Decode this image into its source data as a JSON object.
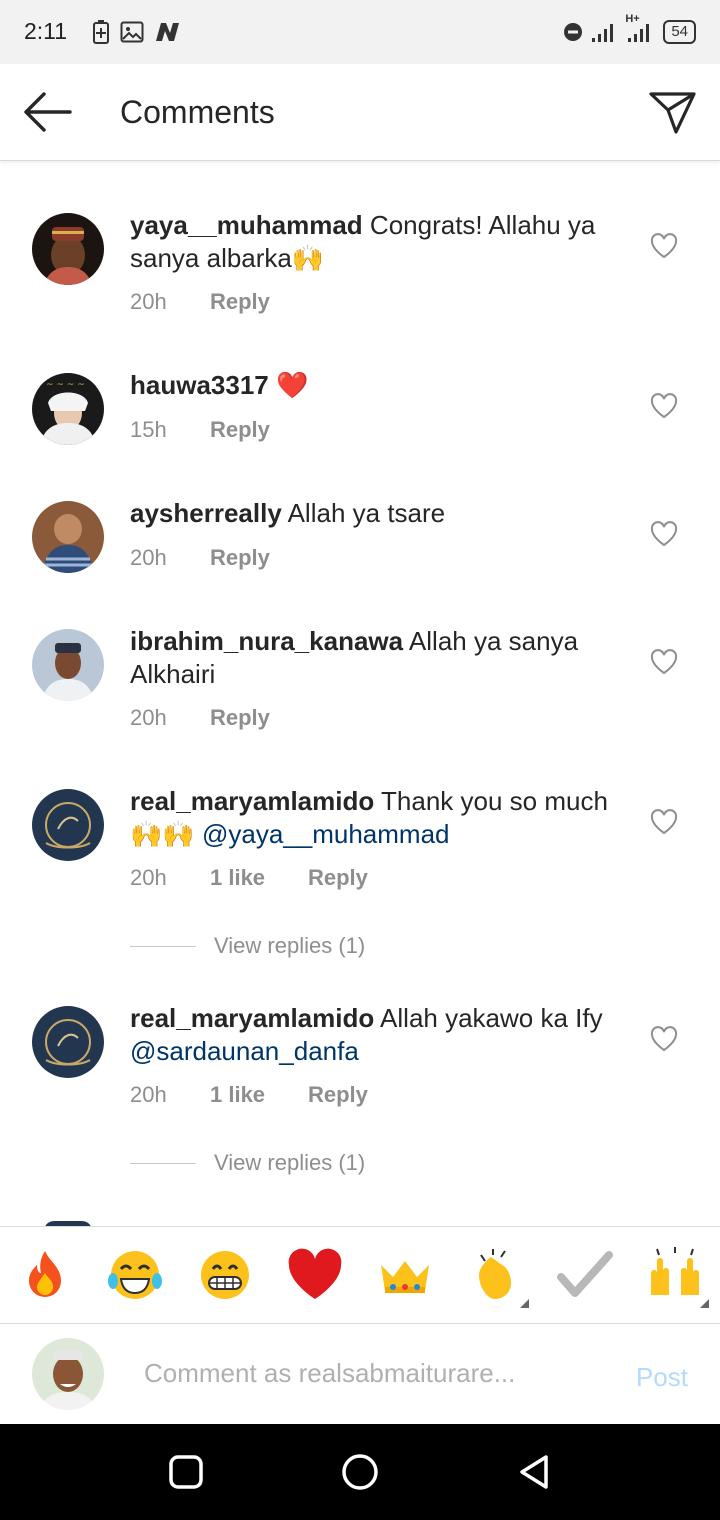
{
  "status": {
    "time": "2:11",
    "signal_label": "H+",
    "battery": "54"
  },
  "header": {
    "title": "Comments",
    "back_icon": "arrow-left-icon",
    "share_icon": "paper-plane-icon"
  },
  "comments": [
    {
      "username": "yaya__muhammad",
      "text": "Congrats! Allahu ya sanya albarka🙌",
      "age": "20h",
      "likes": "",
      "reply": "Reply"
    },
    {
      "username": "hauwa3317",
      "text": "❤️",
      "age": "15h",
      "likes": "",
      "reply": "Reply"
    },
    {
      "username": "aysherreally",
      "text": "Allah ya tsare",
      "age": "20h",
      "likes": "",
      "reply": "Reply"
    },
    {
      "username": "ibrahim_nura_kanawa",
      "text": "Allah ya sanya Alkhairi",
      "age": "20h",
      "likes": "",
      "reply": "Reply"
    },
    {
      "username": "real_maryamlamido",
      "text": "Thank you so much🙌🙌",
      "mention": "@yaya__muhammad",
      "age": "20h",
      "likes": "1 like",
      "reply": "Reply",
      "view_replies": "View replies (1)"
    },
    {
      "username": "real_maryamlamido",
      "text": "Allah yakawo ka Ify",
      "mention": "@sardaunan_danfa",
      "age": "20h",
      "likes": "1 like",
      "reply": "Reply",
      "view_replies": "View replies (1)"
    }
  ],
  "emoji_bar": [
    "🔥",
    "😂",
    "😁",
    "❤️",
    "👑",
    "👏",
    "✔️",
    "🙌"
  ],
  "composer": {
    "placeholder": "Comment as realsabmaiturare...",
    "post_label": "Post"
  },
  "colors": {
    "mention": "#003569",
    "meta": "#8e8e8e",
    "post_disabled": "#b3dbff"
  }
}
